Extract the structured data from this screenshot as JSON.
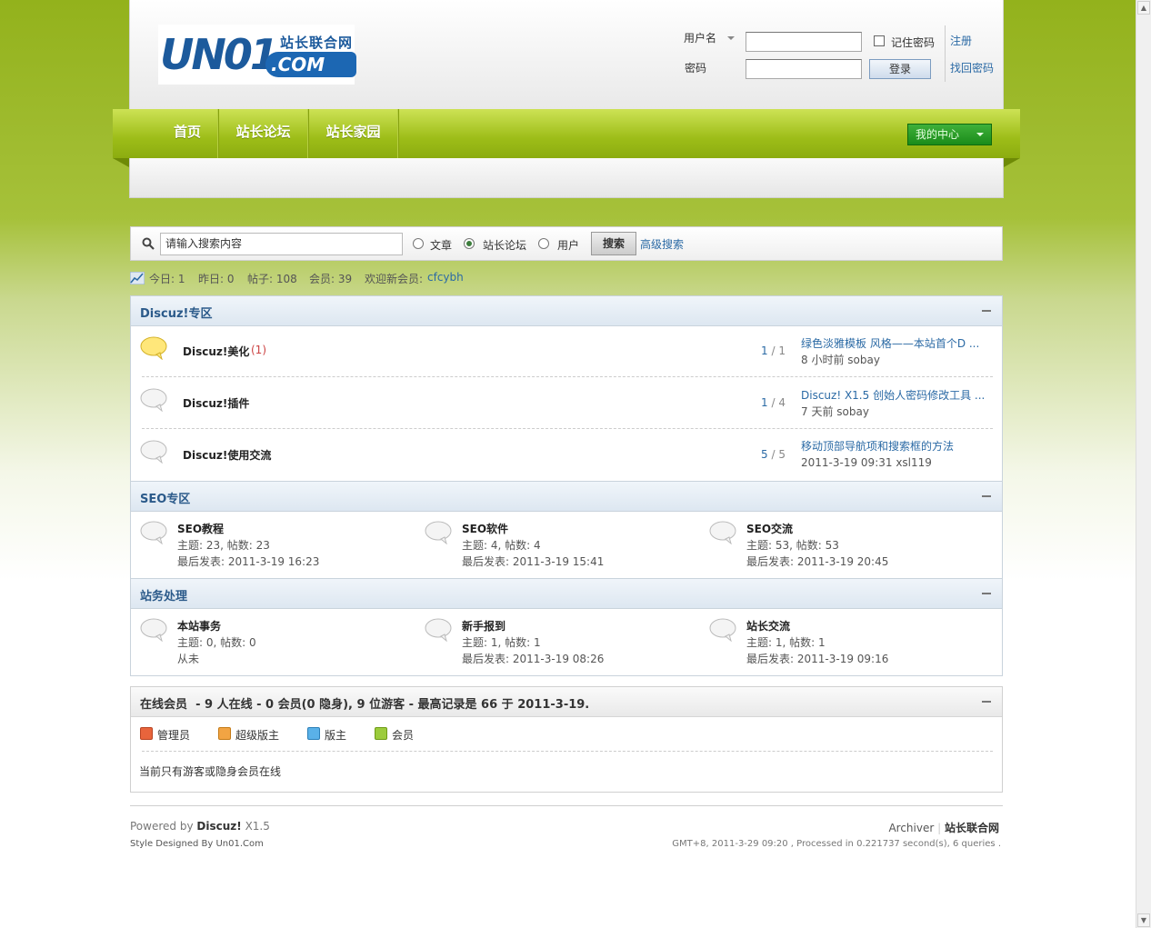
{
  "logo": {
    "main": "UN01",
    "com": ".COM",
    "cn": "站长联合网"
  },
  "login": {
    "username_label": "用户名",
    "password_label": "密码",
    "remember_label": "记住密码",
    "login_button": "登录",
    "register_link": "注册",
    "forgot_link": "找回密码"
  },
  "nav": {
    "items": [
      "首页",
      "站长论坛",
      "站长家园"
    ],
    "mycenter": "我的中心"
  },
  "search": {
    "placeholder": "请输入搜索内容",
    "options": [
      "文章",
      "站长论坛",
      "用户"
    ],
    "selected": "站长论坛",
    "button": "搜索",
    "advanced": "高级搜索"
  },
  "stats": {
    "today": "今日: 1",
    "yesterday": "昨日: 0",
    "posts": "帖子: 108",
    "members": "会员: 39",
    "newmember_label": "欢迎新会员:",
    "newmember": "cfcybh"
  },
  "sections": [
    {
      "title": "Discuz!专区",
      "forums": [
        {
          "name": "Discuz!美化",
          "new": "(1)",
          "threads": "1",
          "posts": "1",
          "last_title": "绿色淡雅模板 风格——本站首个D ...",
          "last_meta": "8 小时前  sobay",
          "has_new": true
        },
        {
          "name": "Discuz!插件",
          "new": "",
          "threads": "1",
          "posts": "4",
          "last_title": "Discuz! X1.5 创始人密码修改工具 ...",
          "last_meta": "7 天前  sobay",
          "has_new": false
        },
        {
          "name": "Discuz!使用交流",
          "new": "",
          "threads": "5",
          "posts": "5",
          "last_title": "移动顶部导航项和搜索框的方法",
          "last_meta": "2011-3-19 09:31  xsl119",
          "has_new": false
        }
      ]
    },
    {
      "title": "SEO专区",
      "cells": [
        {
          "name": "SEO教程",
          "counts": "主题: 23, 帖数: 23",
          "last": "最后发表: 2011-3-19 16:23"
        },
        {
          "name": "SEO软件",
          "counts": "主题: 4, 帖数: 4",
          "last": "最后发表: 2011-3-19 15:41"
        },
        {
          "name": "SEO交流",
          "counts": "主题: 53, 帖数: 53",
          "last": "最后发表: 2011-3-19 20:45"
        }
      ]
    },
    {
      "title": "站务处理",
      "cells": [
        {
          "name": "本站事务",
          "counts": "主题: 0, 帖数: 0",
          "last": "从未"
        },
        {
          "name": "新手报到",
          "counts": "主题: 1, 帖数: 1",
          "last": "最后发表: 2011-3-19 08:26"
        },
        {
          "name": "站长交流",
          "counts": "主题: 1, 帖数: 1",
          "last": "最后发表: 2011-3-19 09:16"
        }
      ]
    }
  ],
  "online": {
    "title": "在线会员",
    "summary": "- 9 人在线  - 0 会员(0 隐身), 9 位游客  - 最高记录是  66 于  2011-3-19.",
    "legend": [
      "管理员",
      "超级版主",
      "版主",
      "会员"
    ],
    "empty_text": "当前只有游客或隐身会员在线"
  },
  "footer": {
    "powered_prefix": "Powered by",
    "powered_name": "Discuz!",
    "powered_ver": "X1.5",
    "designed": "Style Designed By Un01.Com",
    "archiver": "Archiver",
    "site_name": "站长联合网",
    "gmt": "GMT+8, 2011-3-29 09:20 , Processed in 0.221737 second(s), 6 queries ."
  },
  "colors": {
    "accent_green": "#9dbd18",
    "link_blue": "#2b6aa5",
    "new_red": "#c44"
  }
}
